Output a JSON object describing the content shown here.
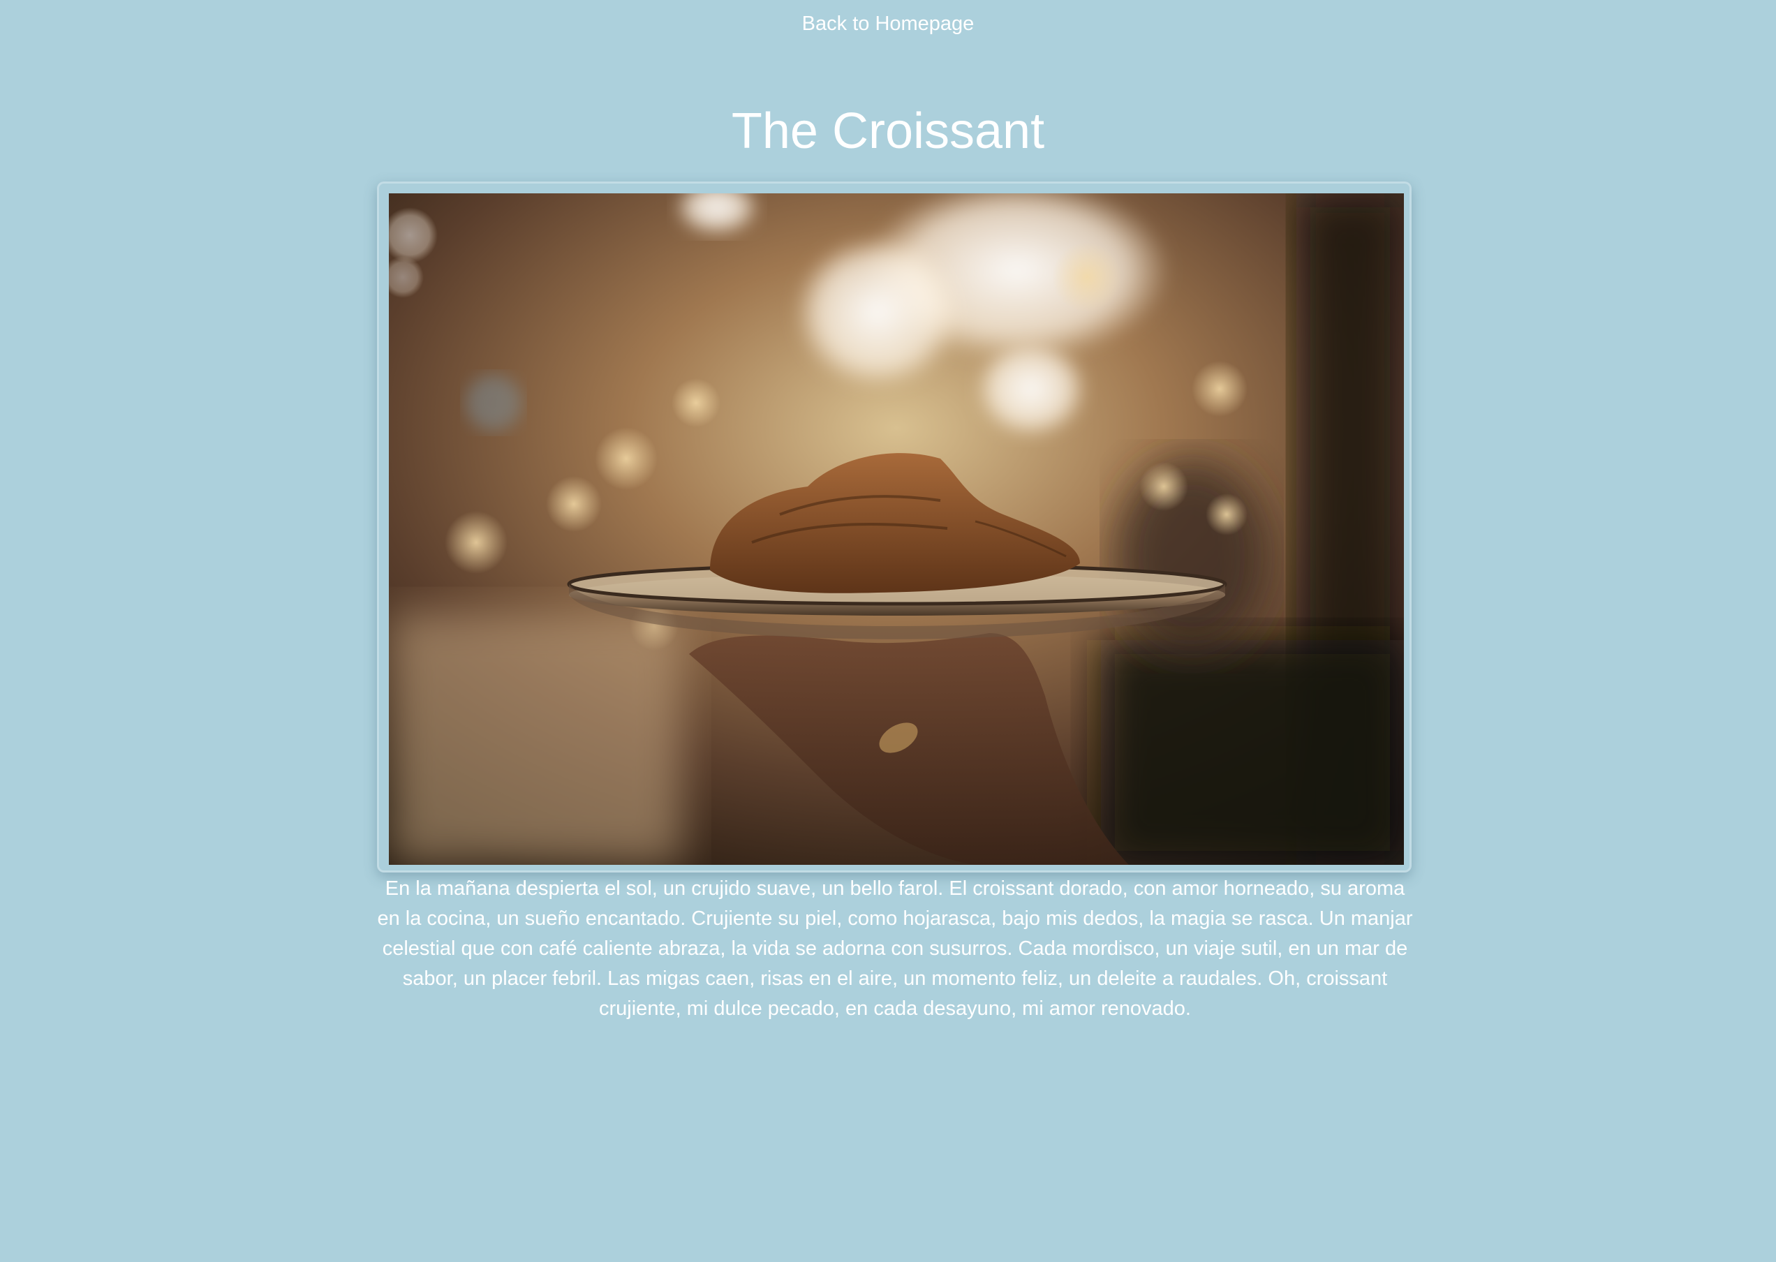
{
  "nav": {
    "back_label": "Back to Homepage"
  },
  "page": {
    "title": "The Croissant",
    "body": "En la mañana despierta el sol, un crujido suave, un bello farol. El croissant dorado, con amor horneado, su aroma en la cocina, un sueño encantado. Crujiente su piel, como hojarasca, bajo mis dedos, la magia se rasca. Un manjar celestial que con café caliente abraza, la vida se adorna con susurros. Cada mordisco, un viaje sutil, en un mar de sabor, un placer febril. Las migas caen, risas en el aire, un momento feliz, un deleite a raudales. Oh, croissant crujiente, mi dulce pecado, en cada desayuno, mi amor renovado."
  },
  "colors": {
    "background": "#acd0dc",
    "text": "#ffffff"
  }
}
